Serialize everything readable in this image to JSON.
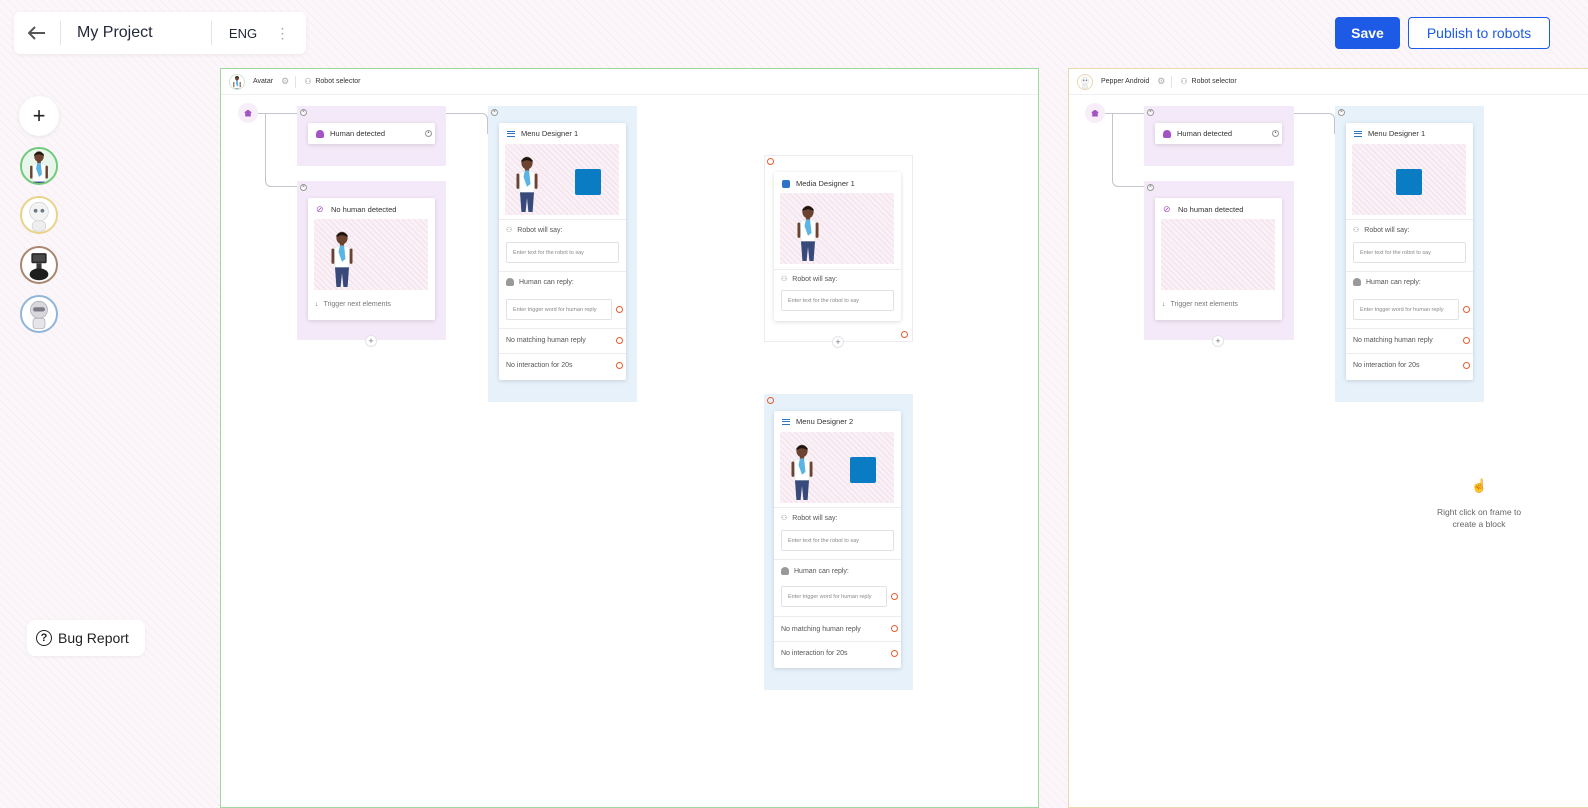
{
  "header": {
    "project_title": "My Project",
    "language": "ENG",
    "save_label": "Save",
    "publish_label": "Publish to robots"
  },
  "sidebar": {
    "add_label": "+",
    "robots": [
      {
        "name": "avatar",
        "border": "#6fc97a"
      },
      {
        "name": "pepper",
        "border": "#e9d28a"
      },
      {
        "name": "temi",
        "border": "#a9866f"
      },
      {
        "name": "nao",
        "border": "#8fb5d8"
      }
    ],
    "bug_report_label": "Bug Report"
  },
  "frames": [
    {
      "robot_name": "Avatar",
      "robot_selector_label": "Robot selector",
      "border": "#9ed9a0",
      "human_detected": "Human detected",
      "no_human_detected": "No human detected",
      "trigger_next": "Trigger next elements",
      "menu_designer_1": {
        "title": "Menu Designer 1",
        "robot_say_label": "Robot will say:",
        "robot_say_placeholder": "Enter text for the robot to say",
        "human_reply_label": "Human can reply:",
        "human_reply_placeholder": "Enter trigger word for human reply",
        "no_match": "No matching human reply",
        "no_interaction": "No interaction for 20s"
      },
      "media_designer_1": {
        "title": "Media Designer 1",
        "robot_say_label": "Robot will say:",
        "robot_say_placeholder": "Enter text for the robot to say"
      },
      "menu_designer_2": {
        "title": "Menu Designer 2",
        "robot_say_label": "Robot will say:",
        "robot_say_placeholder": "Enter text for the robot to say",
        "human_reply_label": "Human can reply:",
        "human_reply_placeholder": "Enter trigger word for human reply",
        "no_match": "No matching human reply",
        "no_interaction": "No interaction for 20s"
      }
    },
    {
      "robot_name": "Pepper Android",
      "robot_selector_label": "Robot selector",
      "border": "#ecd7b0",
      "human_detected": "Human detected",
      "no_human_detected": "No human detected",
      "trigger_next": "Trigger next elements",
      "menu_designer_1": {
        "title": "Menu Designer 1",
        "robot_say_label": "Robot will say:",
        "robot_say_placeholder": "Enter text for the robot to say",
        "human_reply_label": "Human can reply:",
        "human_reply_placeholder": "Enter trigger word for human reply",
        "no_match": "No matching human reply",
        "no_interaction": "No interaction for 20s"
      },
      "hint": "Right click on frame to create a block"
    }
  ],
  "colors": {
    "primary": "#1d5ae6",
    "accent_purple": "#a353c4",
    "block_blue": "#0a7cc4",
    "warning_orange": "#e65c2d"
  }
}
